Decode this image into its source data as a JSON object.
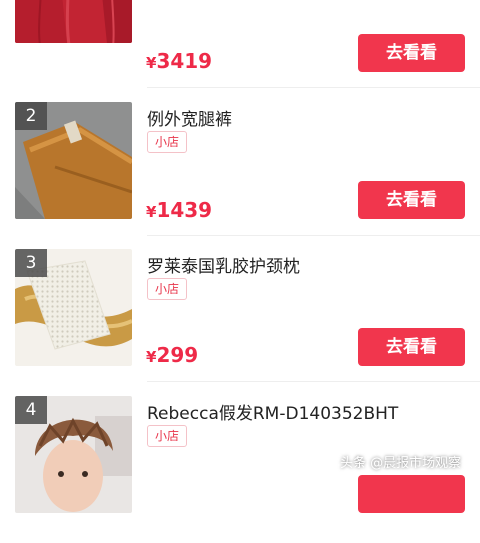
{
  "products": [
    {
      "rank": "",
      "title": "",
      "tag": "",
      "currency": "¥",
      "price": "3419",
      "button": "去看看",
      "image": "red-jacket-image"
    },
    {
      "rank": "2",
      "title": "例外宽腿裤",
      "tag": "小店",
      "currency": "¥",
      "price": "1439",
      "button": "去看看",
      "image": "brown-pants-image"
    },
    {
      "rank": "3",
      "title": "罗莱泰国乳胶护颈枕",
      "tag": "小店",
      "currency": "¥",
      "price": "299",
      "button": "去看看",
      "image": "latex-pillow-image"
    },
    {
      "rank": "4",
      "title": "Rebecca假发RM-D140352BHT",
      "tag": "小店",
      "currency": "",
      "price": "",
      "button": "",
      "image": "wig-model-image"
    }
  ],
  "watermark": "头条 @晨报市场观察",
  "colors": {
    "accent": "#f1364d",
    "price": "#ee2a48",
    "tag_border": "#f4c2c8"
  }
}
